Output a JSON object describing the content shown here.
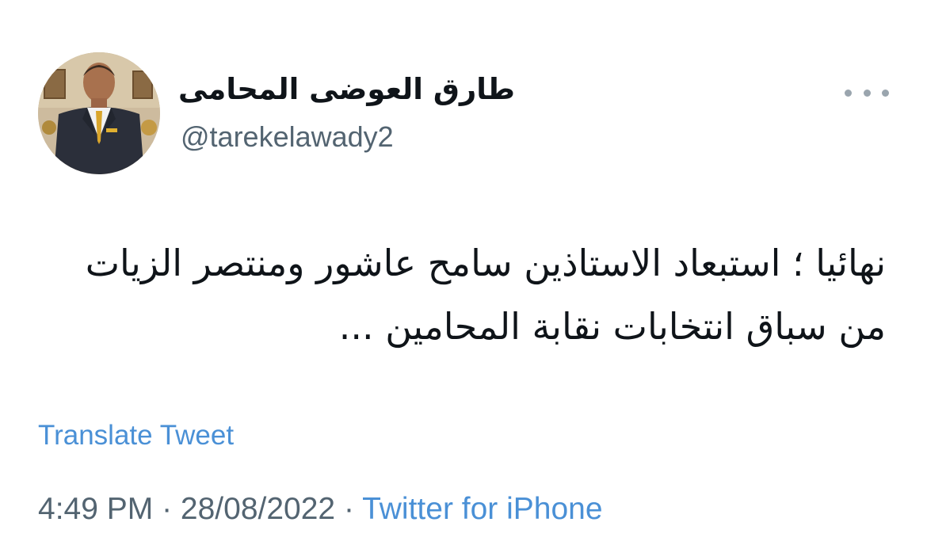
{
  "author": {
    "display_name": "طارق العوضى المحامى",
    "handle": "@tarekelawady2",
    "avatar_icon": "profile-photo-icon"
  },
  "menu": {
    "icon": "more-options-icon"
  },
  "tweet": {
    "text": "نهائيا ؛ استبعاد الاستاذين سامح عاشور ومنتصر الزيات من سباق انتخابات نقابة المحامين ...",
    "translate_label": "Translate Tweet"
  },
  "meta": {
    "time": "4:49 PM",
    "separator": " · ",
    "date": "28/08/2022",
    "source": "Twitter for iPhone"
  },
  "colors": {
    "text_primary": "#0f1419",
    "text_secondary": "#536471",
    "link": "#4a90d6"
  }
}
